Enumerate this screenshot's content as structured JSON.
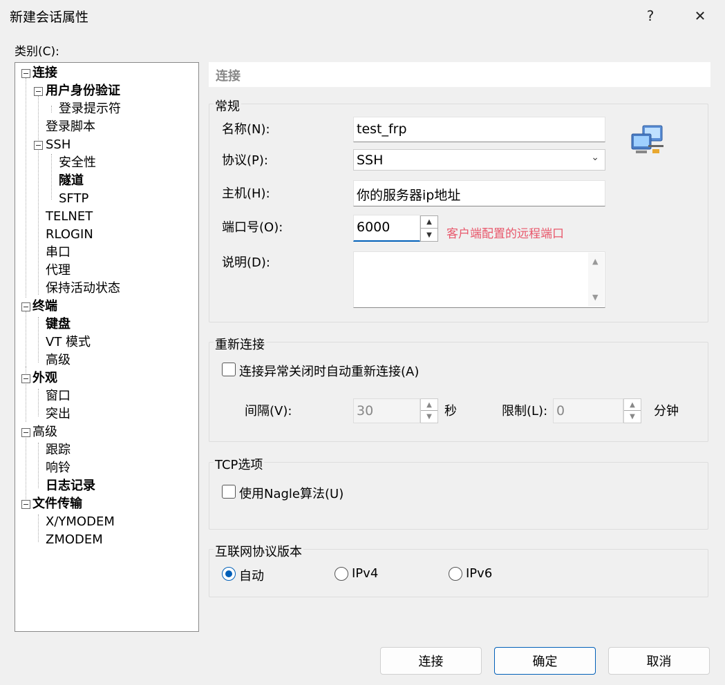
{
  "window": {
    "title": "新建会话属性",
    "help": "?",
    "close": "✕"
  },
  "category_label": "类别(C):",
  "tree": {
    "connection": "连接",
    "user_auth": "用户身份验证",
    "login_prompt": "登录提示符",
    "login_script": "登录脚本",
    "ssh": "SSH",
    "security": "安全性",
    "tunnel": "隧道",
    "sftp": "SFTP",
    "telnet": "TELNET",
    "rlogin": "RLOGIN",
    "serial": "串口",
    "proxy": "代理",
    "keepalive": "保持活动状态",
    "terminal": "终端",
    "keyboard": "键盘",
    "vt_mode": "VT 模式",
    "advanced_term": "高级",
    "appearance": "外观",
    "window": "窗口",
    "highlight": "突出",
    "advanced": "高级",
    "trace": "跟踪",
    "bell": "响铃",
    "logging": "日志记录",
    "file_transfer": "文件传输",
    "xymodem": "X/YMODEM",
    "zmodem": "ZMODEM"
  },
  "panel": {
    "header": "连接",
    "general": {
      "title": "常规",
      "name_label": "名称(N):",
      "name_value": "test_frp",
      "protocol_label": "协议(P):",
      "protocol_value": "SSH",
      "host_label": "主机(H):",
      "host_value": "你的服务器ip地址",
      "port_label": "端口号(O):",
      "port_value": "6000",
      "port_note": "客户端配置的远程端口",
      "desc_label": "说明(D):",
      "desc_value": ""
    },
    "reconnect": {
      "title": "重新连接",
      "auto_label": "连接异常关闭时自动重新连接(A)",
      "interval_label": "间隔(V):",
      "interval_value": "30",
      "interval_unit": "秒",
      "limit_label": "限制(L):",
      "limit_value": "0",
      "limit_unit": "分钟"
    },
    "tcp": {
      "title": "TCP选项",
      "nagle_label": "使用Nagle算法(U)"
    },
    "ip": {
      "title": "互联网协议版本",
      "auto": "自动",
      "ipv4": "IPv4",
      "ipv6": "IPv6"
    }
  },
  "buttons": {
    "connect": "连接",
    "ok": "确定",
    "cancel": "取消"
  }
}
